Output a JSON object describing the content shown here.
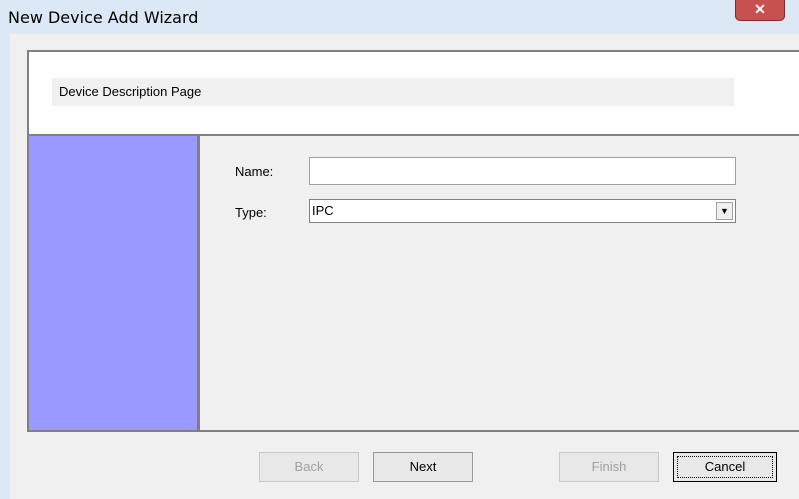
{
  "window": {
    "title": "New Device Add Wizard",
    "close_glyph": "✕"
  },
  "header": {
    "description": "Device Description Page"
  },
  "form": {
    "name_label": "Name:",
    "name_value": "",
    "type_label": "Type:",
    "type_value": "IPC",
    "dropdown_glyph": "▼"
  },
  "buttons": {
    "back": "Back",
    "next": "Next",
    "finish": "Finish",
    "cancel": "Cancel"
  }
}
